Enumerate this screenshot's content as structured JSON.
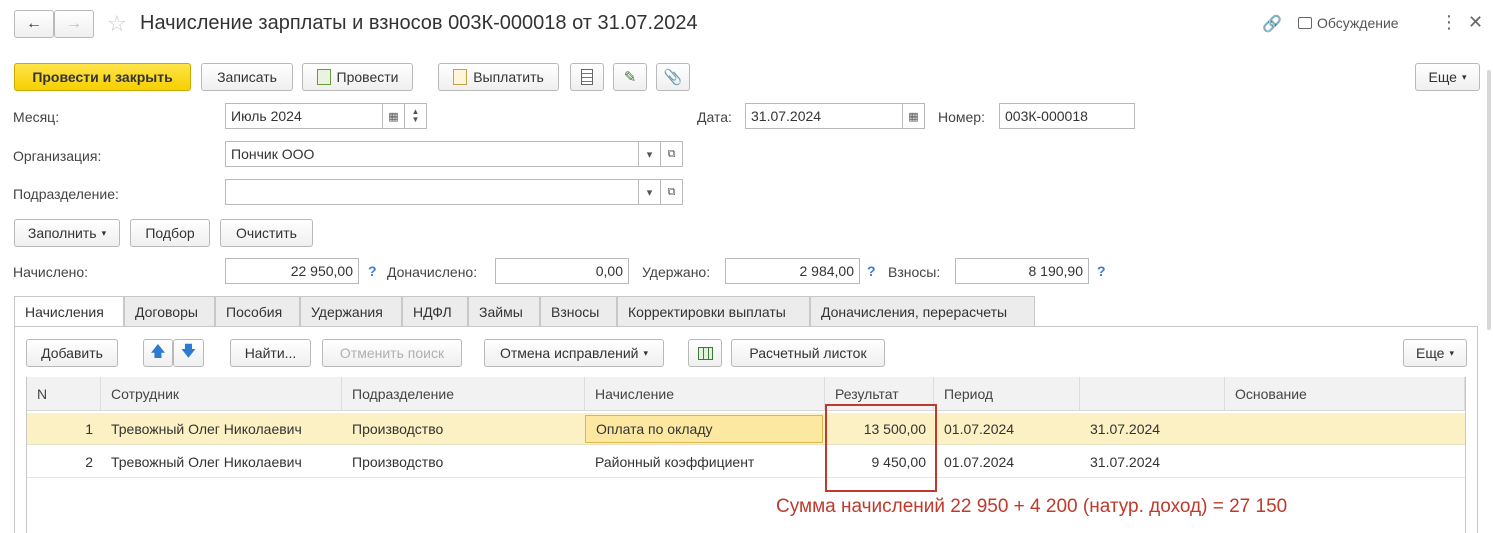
{
  "header": {
    "title": "Начисление зарплаты и взносов 003К-000018 от 31.07.2024",
    "discussion": "Обсуждение"
  },
  "toolbar": {
    "post_close": "Провести и закрыть",
    "save": "Записать",
    "post": "Провести",
    "pay": "Выплатить",
    "more": "Еще"
  },
  "form": {
    "month_label": "Месяц:",
    "month_value": "Июль 2024",
    "date_label": "Дата:",
    "date_value": "31.07.2024",
    "number_label": "Номер:",
    "number_value": "003К-000018",
    "org_label": "Организация:",
    "org_value": "Пончик ООО",
    "dept_label": "Подразделение:",
    "dept_value": ""
  },
  "actions": {
    "fill": "Заполнить",
    "select": "Подбор",
    "clear": "Очистить"
  },
  "totals": {
    "accrued_label": "Начислено:",
    "accrued_value": "22 950,00",
    "additional_label": "Доначислено:",
    "additional_value": "0,00",
    "withheld_label": "Удержано:",
    "withheld_value": "2 984,00",
    "contributions_label": "Взносы:",
    "contributions_value": "8 190,90"
  },
  "tabs": [
    "Начисления",
    "Договоры",
    "Пособия",
    "Удержания",
    "НДФЛ",
    "Займы",
    "Взносы",
    "Корректировки выплаты",
    "Доначисления, перерасчеты"
  ],
  "table_toolbar": {
    "add": "Добавить",
    "find": "Найти...",
    "cancel_search": "Отменить поиск",
    "cancel_corrections": "Отмена исправлений",
    "payslip": "Расчетный листок",
    "more": "Еще"
  },
  "table": {
    "columns": [
      "N",
      "Сотрудник",
      "Подразделение",
      "Начисление",
      "Результат",
      "Период",
      "",
      "Основание"
    ],
    "rows": [
      {
        "n": "1",
        "employee": "Тревожный Олег Николаевич",
        "dept": "Производство",
        "accrual": "Оплата по окладу",
        "result": "13 500,00",
        "from": "01.07.2024",
        "to": "31.07.2024",
        "basis": ""
      },
      {
        "n": "2",
        "employee": "Тревожный Олег Николаевич",
        "dept": "Производство",
        "accrual": "Районный коэффициент",
        "result": "9 450,00",
        "from": "01.07.2024",
        "to": "31.07.2024",
        "basis": ""
      }
    ]
  },
  "annotation": {
    "text": "Сумма начислений 22 950 + 4 200 (натур. доход) = 27 150",
    "color": "#c0392b"
  }
}
